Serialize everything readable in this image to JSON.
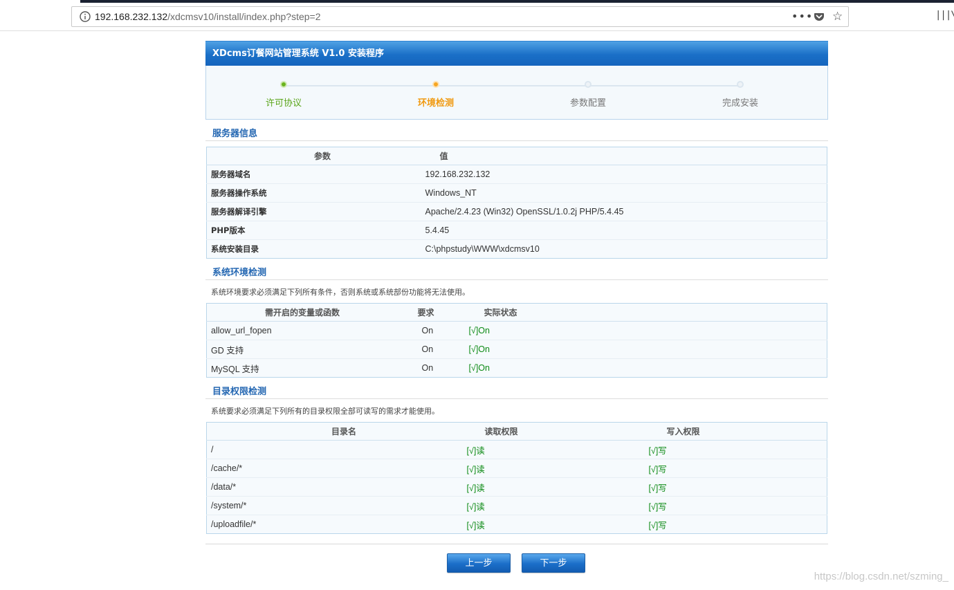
{
  "browser": {
    "url_host": "192.168.232.132",
    "url_path": "/xdcmsv10/install/index.php?step=2",
    "menu_dots": "•••",
    "star_glyph": "☆",
    "library_glyph": "|||\\"
  },
  "installer": {
    "title": "XDcms订餐网站管理系统 V1.0 安装程序",
    "steps": [
      {
        "label": "许可协议",
        "state": "done"
      },
      {
        "label": "环境检测",
        "state": "current"
      },
      {
        "label": "参数配置",
        "state": "pending"
      },
      {
        "label": "完成安装",
        "state": "pending"
      }
    ]
  },
  "server_info": {
    "heading": "服务器信息",
    "col_param": "参数",
    "col_value": "值",
    "rows": [
      {
        "k": "服务器域名",
        "v": "192.168.232.132"
      },
      {
        "k": "服务器操作系统",
        "v": "Windows_NT"
      },
      {
        "k": "服务器解译引擎",
        "v": "Apache/2.4.23 (Win32) OpenSSL/1.0.2j PHP/5.4.45"
      },
      {
        "k": "PHP版本",
        "v": "5.4.45"
      },
      {
        "k": "系统安装目录",
        "v": "C:\\phpstudy\\WWW\\xdcmsv10"
      }
    ]
  },
  "env_check": {
    "heading": "系统环境检测",
    "desc": "系统环境要求必须满足下列所有条件，否则系统或系统部份功能将无法使用。",
    "col_name": "需开启的变量或函数",
    "col_req": "要求",
    "col_status": "实际状态",
    "rows": [
      {
        "name": "allow_url_fopen",
        "req": "On",
        "status": "[√]On"
      },
      {
        "name": "GD 支持",
        "req": "On",
        "status": "[√]On"
      },
      {
        "name": "MySQL 支持",
        "req": "On",
        "status": "[√]On"
      }
    ]
  },
  "dir_check": {
    "heading": "目录权限检测",
    "desc": "系统要求必须满足下列所有的目录权限全部可读写的需求才能使用。",
    "col_dir": "目录名",
    "col_read": "读取权限",
    "col_write": "写入权限",
    "rows": [
      {
        "dir": "/",
        "read": "[√]读",
        "write": "[√]写"
      },
      {
        "dir": "/cache/*",
        "read": "[√]读",
        "write": "[√]写"
      },
      {
        "dir": "/data/*",
        "read": "[√]读",
        "write": "[√]写"
      },
      {
        "dir": "/system/*",
        "read": "[√]读",
        "write": "[√]写"
      },
      {
        "dir": "/uploadfile/*",
        "read": "[√]读",
        "write": "[√]写"
      }
    ]
  },
  "buttons": {
    "prev": "上一步",
    "next": "下一步"
  },
  "watermark": "https://blog.csdn.net/szming_",
  "colors": {
    "accent": "#1a6fc7",
    "ok": "#0c8a14",
    "current_step": "#f09a11",
    "done_step": "#5aa51a"
  }
}
